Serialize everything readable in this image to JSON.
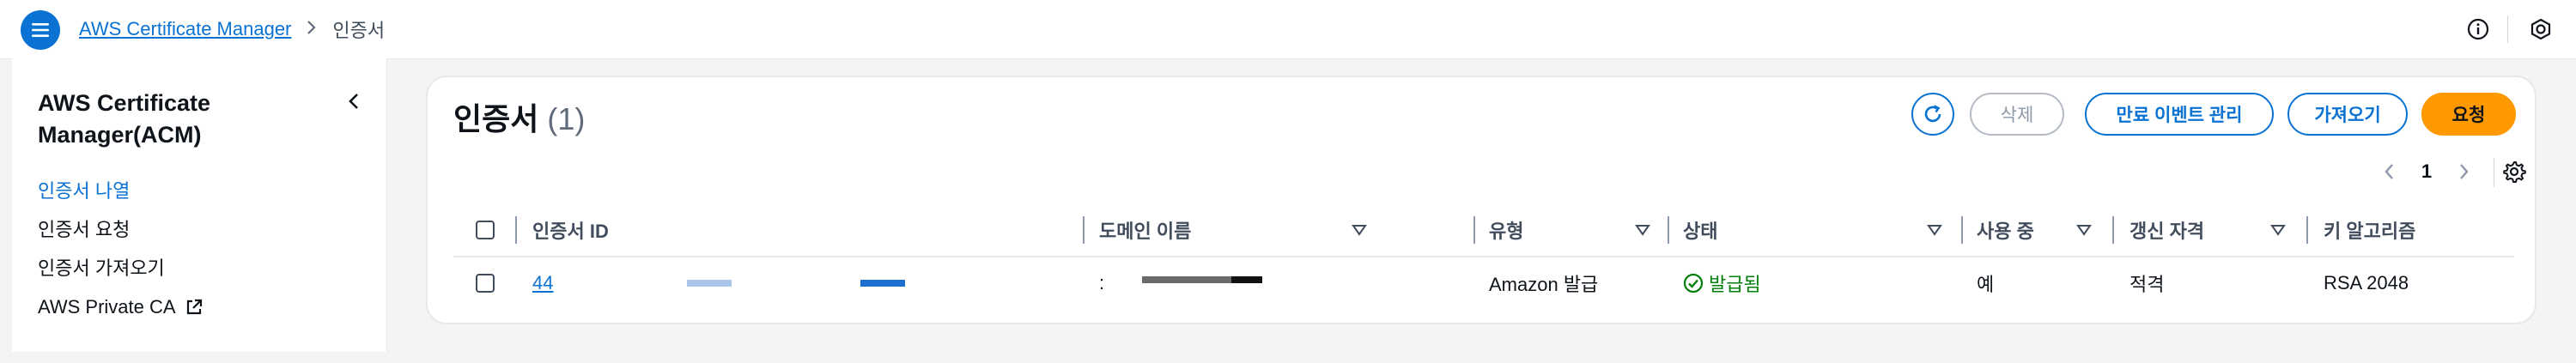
{
  "topbar": {
    "breadcrumb": [
      {
        "label": "AWS Certificate Manager"
      },
      {
        "label": "인증서"
      }
    ]
  },
  "sidebar": {
    "title": "AWS Certificate Manager(ACM)",
    "items": [
      {
        "label": "인증서 나열",
        "active": true
      },
      {
        "label": "인증서 요청",
        "active": false
      },
      {
        "label": "인증서 가져오기",
        "active": false
      },
      {
        "label": "AWS Private CA",
        "active": false,
        "external": true
      }
    ]
  },
  "main": {
    "title": "인증서",
    "count": "(1)",
    "buttons": {
      "delete": "삭제",
      "manage_expiry_events": "만료 이벤트 관리",
      "import": "가져오기",
      "request": "요청"
    },
    "pagination": {
      "current_page": "1"
    }
  },
  "table": {
    "columns": [
      "인증서 ID",
      "도메인 이름",
      "유형",
      "상태",
      "사용 중",
      "갱신 자격",
      "키 알고리즘"
    ],
    "rows": [
      {
        "certificate_id": "44",
        "domain_name": ":",
        "type": "Amazon 발급",
        "status": "발급됨",
        "in_use": "예",
        "renewal_eligibility": "적격",
        "key_algorithm": "RSA 2048"
      }
    ]
  },
  "colors": {
    "accent": "#0972d3",
    "primary_button": "#ff9900",
    "success": "#037f0c"
  }
}
